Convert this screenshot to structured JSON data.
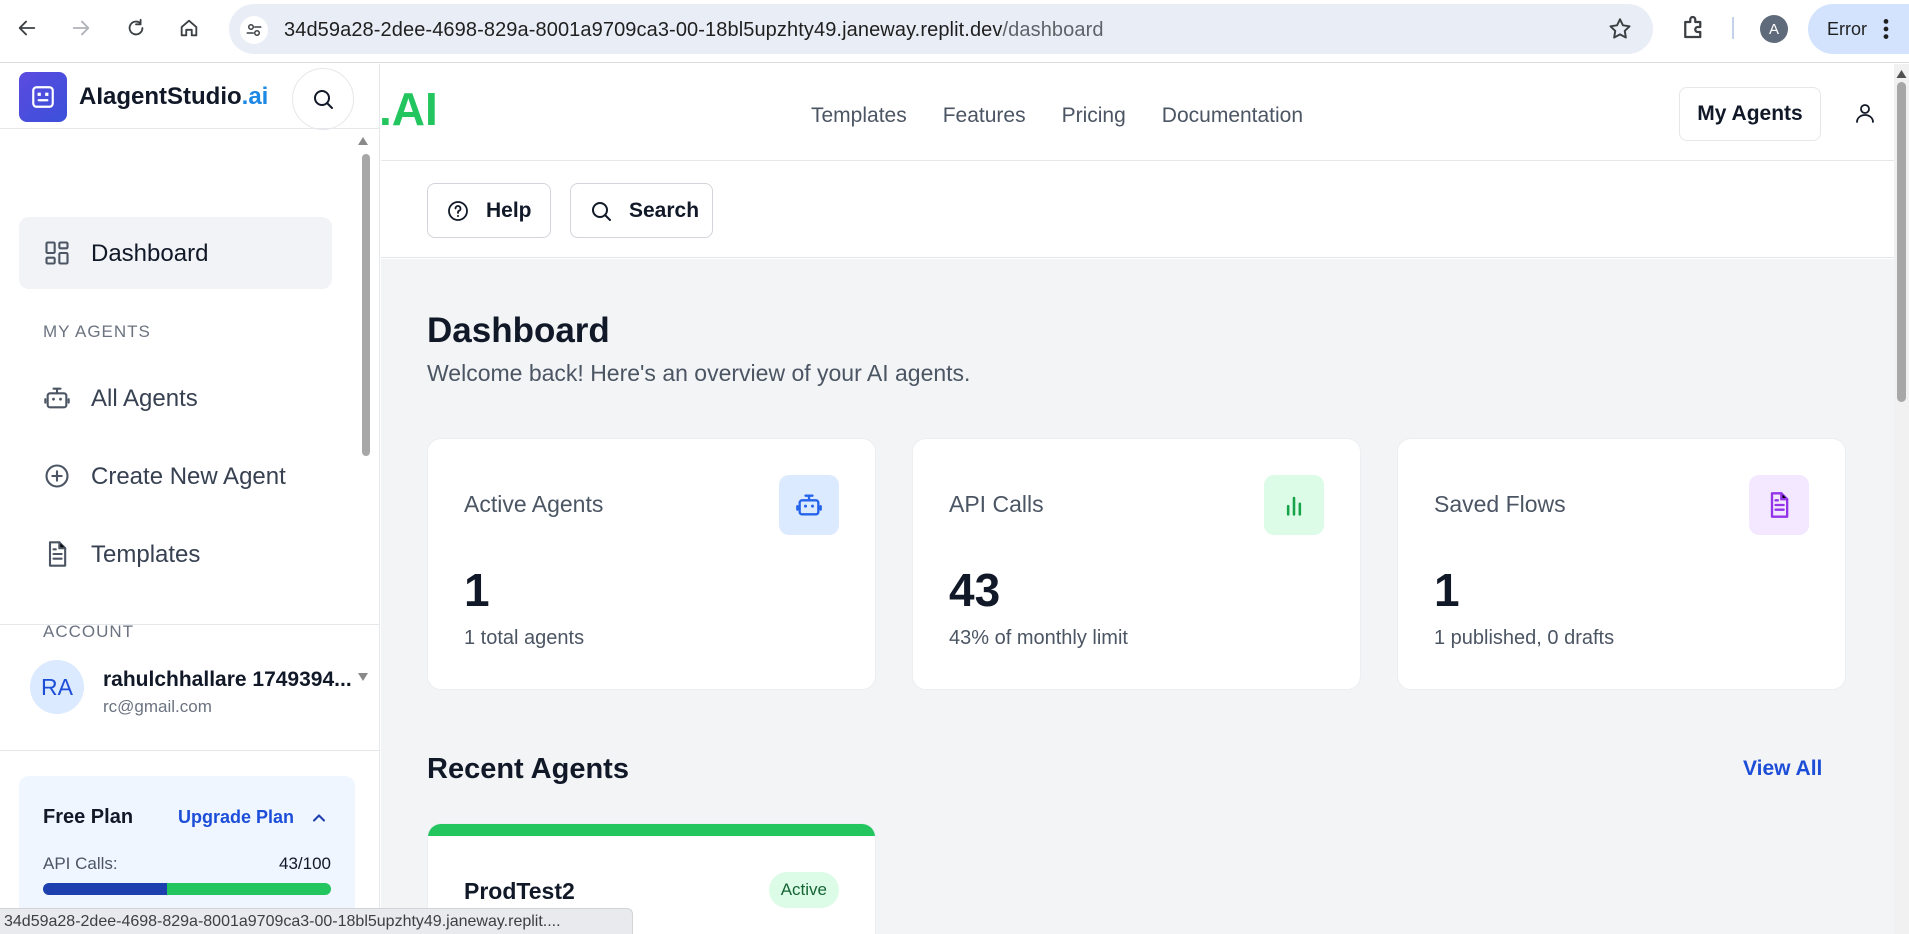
{
  "browser": {
    "url_host": "34d59a28-2dee-4698-829a-8001a9709ca3-00-18bl5upzhty49.janeway.replit.dev",
    "url_path": "/dashboard",
    "profile_initial": "A",
    "error_label": "Error",
    "status_url": "34d59a28-2dee-4698-829a-8001a9709ca3-00-18bl5upzhty49.janeway.replit...."
  },
  "sidebar": {
    "brand_main": "AIagentStudio",
    "brand_suffix": ".ai",
    "dashboard_label": "Dashboard",
    "section_agents": "MY AGENTS",
    "all_agents_label": "All Agents",
    "create_agent_label": "Create New Agent",
    "templates_label": "Templates",
    "section_account": "ACCOUNT",
    "user": {
      "initials": "RA",
      "name": "rahulchhallare 1749394...",
      "email": "rc@gmail.com"
    },
    "plan": {
      "title": "Free Plan",
      "upgrade_label": "Upgrade Plan",
      "api_label": "API Calls:",
      "api_value": "43/100",
      "api_used_fraction": 0.43
    }
  },
  "header": {
    "logo_partial": ".AI",
    "nav": [
      "Templates",
      "Features",
      "Pricing",
      "Documentation"
    ],
    "my_agents_label": "My Agents"
  },
  "toolbar": {
    "help_label": "Help",
    "search_label": "Search"
  },
  "main": {
    "title": "Dashboard",
    "subtitle": "Welcome back! Here's an overview of your AI agents.",
    "stats": [
      {
        "label": "Active Agents",
        "value": "1",
        "note": "1 total agents",
        "icon": "robot-icon",
        "color": "#2563eb",
        "bg": "#dbeafe"
      },
      {
        "label": "API Calls",
        "value": "43",
        "note": "43% of monthly limit",
        "icon": "bar-chart-icon",
        "color": "#16a34a",
        "bg": "#dcfce7"
      },
      {
        "label": "Saved Flows",
        "value": "1",
        "note": "1 published, 0 drafts",
        "icon": "document-icon",
        "color": "#9333ea",
        "bg": "#f3e8ff"
      }
    ],
    "recent_title": "Recent Agents",
    "view_all_label": "View All",
    "recent_agents": [
      {
        "name": "ProdTest2",
        "status": "Active"
      }
    ]
  },
  "colors": {
    "accent_blue": "#1d4ed8",
    "accent_green": "#22c55e",
    "brand_gradient_start": "#5b4be0"
  }
}
